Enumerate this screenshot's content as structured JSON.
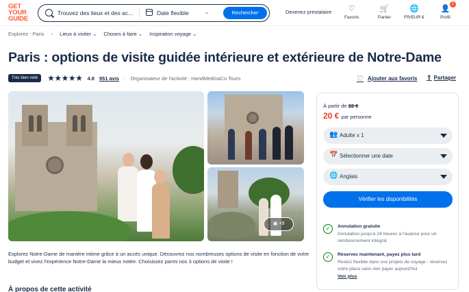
{
  "header": {
    "logo_line1": "GET",
    "logo_line2": "YOUR",
    "logo_line3": "GUIDE",
    "search_placeholder": "Trouvez des lieux et des ac...",
    "date_label": "Date flexible",
    "search_button": "Rechercher",
    "partner_link": "Devenez prestataire",
    "nav": [
      {
        "label": "Favoris",
        "icon": "heart-icon"
      },
      {
        "label": "Panier",
        "icon": "cart-icon"
      },
      {
        "label": "FR/EUR €",
        "icon": "globe-icon"
      },
      {
        "label": "Profil",
        "icon": "person-icon"
      }
    ],
    "profile_badge": "1"
  },
  "breadcrumb": {
    "root": "Explorez : Paris",
    "items": [
      "Lieux à visiter",
      "Choses à faire",
      "Inspiration voyage"
    ]
  },
  "title": "Paris : options de visite guidée intérieure et extérieure de Notre-Dame",
  "rating": {
    "tag": "Très bien noté",
    "stars": "★★★★★",
    "score": "4.8",
    "reviews": "951 avis",
    "separator": "·",
    "organizer": "Organisateur de l'activité : HandMedinaCo Tours"
  },
  "actions": {
    "favorite": "Ajouter aux favoris",
    "share": "Partager"
  },
  "gallery": {
    "more_count": "+9"
  },
  "booking": {
    "from_label": "À partir de",
    "old_price": "22 €",
    "price": "20 €",
    "per": "par personne",
    "participants": "Adulte x 1",
    "date": "Sélectionner une date",
    "language": "Anglais",
    "cta": "Vérifier les disponibilités",
    "benefits": [
      {
        "title": "Annulation gratuite",
        "desc": "Annulation jusqu'à 24 heures à l'avance pour un remboursement intégral"
      },
      {
        "title": "Réservez maintenant, payez plus tard",
        "desc": "Restez flexible dans vos projets de voyage : réservez votre place sans rien payer aujourd'hui",
        "link": "Voir plus"
      }
    ]
  },
  "description": "Explorez Notre-Dame de manière intime grâce à un accès unique. Découvrez nos nombreuses options de visite en fonction de votre budget et vivez l'expérience Notre-Dame la mieux notée. Choisissez parmi nos 3 options de visite !",
  "about_heading": "À propos de cette activité",
  "colors": {
    "brand": "#ff5533",
    "primary": "#0071eb",
    "text": "#1a2b49",
    "price": "#eb3b23",
    "success": "#008009"
  }
}
